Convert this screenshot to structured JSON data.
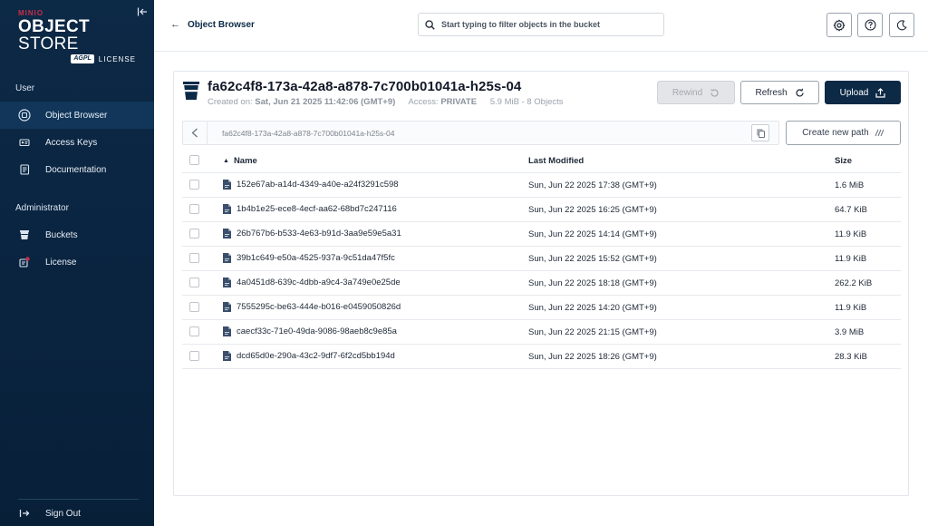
{
  "sidebar": {
    "logo": {
      "brand": "MINIO",
      "title_bold": "OBJECT",
      "title_thin": " STORE",
      "badge": "AGPL",
      "license": "LICENSE"
    },
    "sections": [
      {
        "label": "User",
        "items": [
          {
            "label": "Object Browser",
            "icon": "folder-icon",
            "active": true
          },
          {
            "label": "Access Keys",
            "icon": "key-icon"
          },
          {
            "label": "Documentation",
            "icon": "document-icon"
          }
        ]
      },
      {
        "label": "Administrator",
        "items": [
          {
            "label": "Buckets",
            "icon": "bucket-icon"
          },
          {
            "label": "License",
            "icon": "license-icon"
          }
        ]
      }
    ],
    "sign_out": "Sign Out"
  },
  "topbar": {
    "back_label": "Object Browser",
    "search_placeholder": "Start typing to filter objects in the bucket"
  },
  "bucket": {
    "name": "fa62c4f8-173a-42a8-a878-7c700b01041a-h25s-04",
    "created_label": "Created on:",
    "created_value": "Sat, Jun 21 2025 11:42:06 (GMT+9)",
    "access_label": "Access:",
    "access_value": "PRIVATE",
    "summary": "5.9 MiB - 8 Objects",
    "path": "fa62c4f8-173a-42a8-a878-7c700b01041a-h25s-04"
  },
  "buttons": {
    "rewind": "Rewind",
    "refresh": "Refresh",
    "upload": "Upload",
    "create_path": "Create new path"
  },
  "table": {
    "headers": {
      "name": "Name",
      "modified": "Last Modified",
      "size": "Size"
    },
    "sort": "name-ascending",
    "rows": [
      {
        "name": "152e67ab-a14d-4349-a40e-a24f3291c598",
        "modified": "Sun, Jun 22 2025 17:38 (GMT+9)",
        "size": "1.6 MiB"
      },
      {
        "name": "1b4b1e25-ece8-4ecf-aa62-68bd7c247116",
        "modified": "Sun, Jun 22 2025 16:25 (GMT+9)",
        "size": "64.7 KiB"
      },
      {
        "name": "26b767b6-b533-4e63-b91d-3aa9e59e5a31",
        "modified": "Sun, Jun 22 2025 14:14 (GMT+9)",
        "size": "11.9 KiB"
      },
      {
        "name": "39b1c649-e50a-4525-937a-9c51da47f5fc",
        "modified": "Sun, Jun 22 2025 15:52 (GMT+9)",
        "size": "11.9 KiB"
      },
      {
        "name": "4a0451d8-639c-4dbb-a9c4-3a749e0e25de",
        "modified": "Sun, Jun 22 2025 18:18 (GMT+9)",
        "size": "262.2 KiB"
      },
      {
        "name": "7555295c-be63-444e-b016-e0459050826d",
        "modified": "Sun, Jun 22 2025 14:20 (GMT+9)",
        "size": "11.9 KiB"
      },
      {
        "name": "caecf33c-71e0-49da-9086-98aeb8c9e85a",
        "modified": "Sun, Jun 22 2025 21:15 (GMT+9)",
        "size": "3.9 MiB"
      },
      {
        "name": "dcd65d0e-290a-43c2-9df7-6f2cd5bb194d",
        "modified": "Sun, Jun 22 2025 18:26 (GMT+9)",
        "size": "28.3 KiB"
      }
    ]
  },
  "colors": {
    "sidebar_bg": "#0c2946",
    "upload_bg": "#0c2946",
    "license_dot": "#c72e49"
  }
}
